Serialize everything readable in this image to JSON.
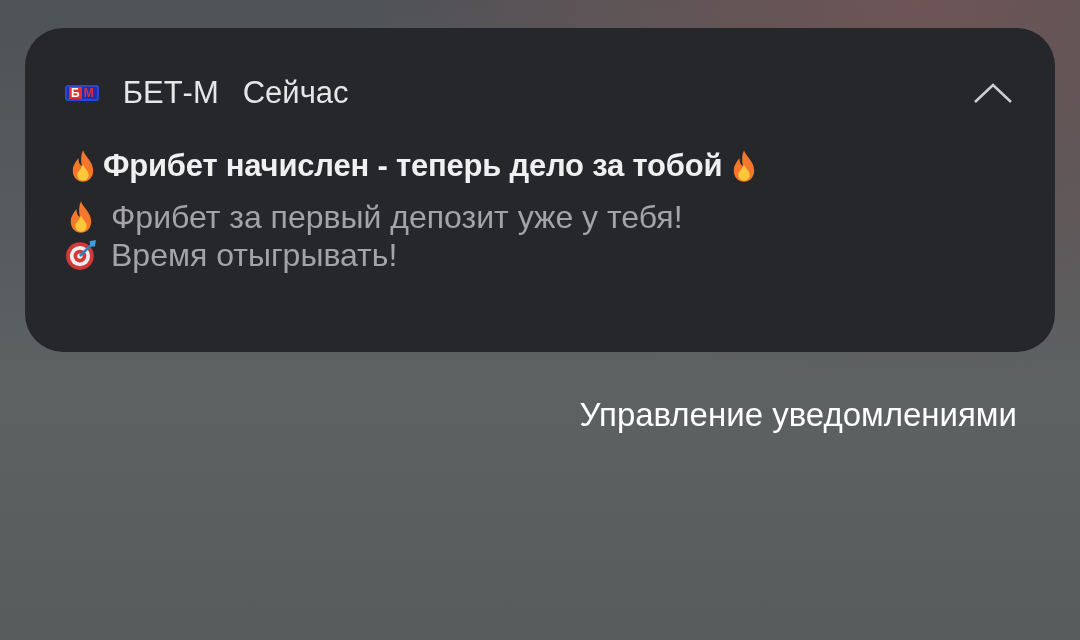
{
  "notification": {
    "logo": {
      "letters": [
        "Б",
        "М"
      ]
    },
    "app_name": "БЕТ-М",
    "time": "Сейчас",
    "expanded": true,
    "title": "Фрибет начислен - теперь дело за тобой",
    "body": [
      {
        "kind": "fire",
        "text": "Фрибет за первый депозит уже у тебя!"
      },
      {
        "kind": "target",
        "text": "Время отыгрывать!"
      }
    ]
  },
  "manage_link": "Управление уведомлениями"
}
